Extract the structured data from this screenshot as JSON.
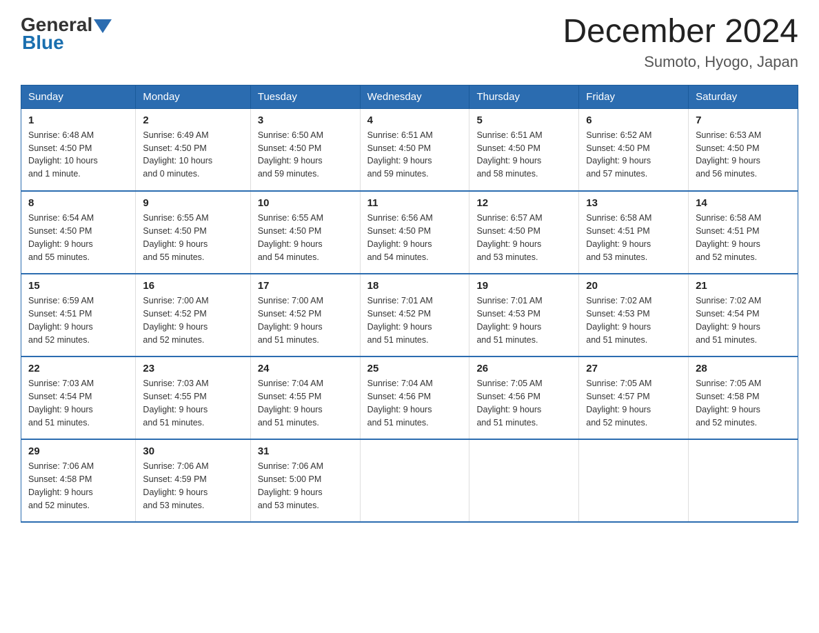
{
  "header": {
    "logo": {
      "general": "General",
      "blue": "Blue"
    },
    "title": "December 2024",
    "subtitle": "Sumoto, Hyogo, Japan"
  },
  "columns": [
    "Sunday",
    "Monday",
    "Tuesday",
    "Wednesday",
    "Thursday",
    "Friday",
    "Saturday"
  ],
  "weeks": [
    [
      {
        "day": "1",
        "sunrise": "6:48 AM",
        "sunset": "4:50 PM",
        "daylight": "10 hours and 1 minute."
      },
      {
        "day": "2",
        "sunrise": "6:49 AM",
        "sunset": "4:50 PM",
        "daylight": "10 hours and 0 minutes."
      },
      {
        "day": "3",
        "sunrise": "6:50 AM",
        "sunset": "4:50 PM",
        "daylight": "9 hours and 59 minutes."
      },
      {
        "day": "4",
        "sunrise": "6:51 AM",
        "sunset": "4:50 PM",
        "daylight": "9 hours and 59 minutes."
      },
      {
        "day": "5",
        "sunrise": "6:51 AM",
        "sunset": "4:50 PM",
        "daylight": "9 hours and 58 minutes."
      },
      {
        "day": "6",
        "sunrise": "6:52 AM",
        "sunset": "4:50 PM",
        "daylight": "9 hours and 57 minutes."
      },
      {
        "day": "7",
        "sunrise": "6:53 AM",
        "sunset": "4:50 PM",
        "daylight": "9 hours and 56 minutes."
      }
    ],
    [
      {
        "day": "8",
        "sunrise": "6:54 AM",
        "sunset": "4:50 PM",
        "daylight": "9 hours and 55 minutes."
      },
      {
        "day": "9",
        "sunrise": "6:55 AM",
        "sunset": "4:50 PM",
        "daylight": "9 hours and 55 minutes."
      },
      {
        "day": "10",
        "sunrise": "6:55 AM",
        "sunset": "4:50 PM",
        "daylight": "9 hours and 54 minutes."
      },
      {
        "day": "11",
        "sunrise": "6:56 AM",
        "sunset": "4:50 PM",
        "daylight": "9 hours and 54 minutes."
      },
      {
        "day": "12",
        "sunrise": "6:57 AM",
        "sunset": "4:50 PM",
        "daylight": "9 hours and 53 minutes."
      },
      {
        "day": "13",
        "sunrise": "6:58 AM",
        "sunset": "4:51 PM",
        "daylight": "9 hours and 53 minutes."
      },
      {
        "day": "14",
        "sunrise": "6:58 AM",
        "sunset": "4:51 PM",
        "daylight": "9 hours and 52 minutes."
      }
    ],
    [
      {
        "day": "15",
        "sunrise": "6:59 AM",
        "sunset": "4:51 PM",
        "daylight": "9 hours and 52 minutes."
      },
      {
        "day": "16",
        "sunrise": "7:00 AM",
        "sunset": "4:52 PM",
        "daylight": "9 hours and 52 minutes."
      },
      {
        "day": "17",
        "sunrise": "7:00 AM",
        "sunset": "4:52 PM",
        "daylight": "9 hours and 51 minutes."
      },
      {
        "day": "18",
        "sunrise": "7:01 AM",
        "sunset": "4:52 PM",
        "daylight": "9 hours and 51 minutes."
      },
      {
        "day": "19",
        "sunrise": "7:01 AM",
        "sunset": "4:53 PM",
        "daylight": "9 hours and 51 minutes."
      },
      {
        "day": "20",
        "sunrise": "7:02 AM",
        "sunset": "4:53 PM",
        "daylight": "9 hours and 51 minutes."
      },
      {
        "day": "21",
        "sunrise": "7:02 AM",
        "sunset": "4:54 PM",
        "daylight": "9 hours and 51 minutes."
      }
    ],
    [
      {
        "day": "22",
        "sunrise": "7:03 AM",
        "sunset": "4:54 PM",
        "daylight": "9 hours and 51 minutes."
      },
      {
        "day": "23",
        "sunrise": "7:03 AM",
        "sunset": "4:55 PM",
        "daylight": "9 hours and 51 minutes."
      },
      {
        "day": "24",
        "sunrise": "7:04 AM",
        "sunset": "4:55 PM",
        "daylight": "9 hours and 51 minutes."
      },
      {
        "day": "25",
        "sunrise": "7:04 AM",
        "sunset": "4:56 PM",
        "daylight": "9 hours and 51 minutes."
      },
      {
        "day": "26",
        "sunrise": "7:05 AM",
        "sunset": "4:56 PM",
        "daylight": "9 hours and 51 minutes."
      },
      {
        "day": "27",
        "sunrise": "7:05 AM",
        "sunset": "4:57 PM",
        "daylight": "9 hours and 52 minutes."
      },
      {
        "day": "28",
        "sunrise": "7:05 AM",
        "sunset": "4:58 PM",
        "daylight": "9 hours and 52 minutes."
      }
    ],
    [
      {
        "day": "29",
        "sunrise": "7:06 AM",
        "sunset": "4:58 PM",
        "daylight": "9 hours and 52 minutes."
      },
      {
        "day": "30",
        "sunrise": "7:06 AM",
        "sunset": "4:59 PM",
        "daylight": "9 hours and 53 minutes."
      },
      {
        "day": "31",
        "sunrise": "7:06 AM",
        "sunset": "5:00 PM",
        "daylight": "9 hours and 53 minutes."
      },
      null,
      null,
      null,
      null
    ]
  ],
  "labels": {
    "sunrise": "Sunrise:",
    "sunset": "Sunset:",
    "daylight": "Daylight:"
  }
}
